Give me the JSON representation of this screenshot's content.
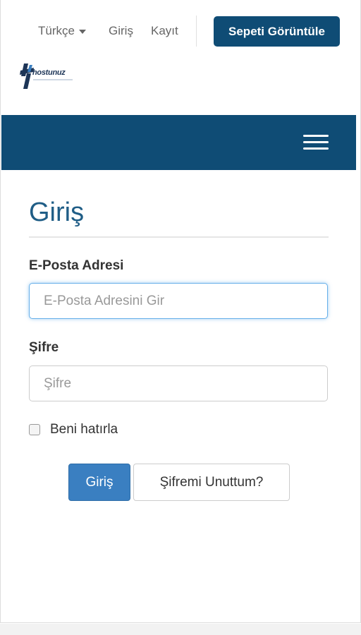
{
  "header": {
    "language_label": "Türkçe",
    "login_link": "Giriş",
    "register_link": "Kayıt",
    "cart_button": "Sepeti Görüntüle",
    "logo_text": "hostunuz"
  },
  "nav": {
    "menu_icon": "hamburger-menu-icon"
  },
  "form": {
    "title": "Giriş",
    "email_label": "E-Posta Adresi",
    "email_placeholder": "E-Posta Adresini Gir",
    "password_label": "Şifre",
    "password_placeholder": "Şifre",
    "remember_label": "Beni hatırla",
    "submit_button": "Giriş",
    "forgot_button": "Şifremi Unuttum?"
  },
  "colors": {
    "brand": "#0f4c75",
    "primary_button": "#3a7fc1",
    "title": "#1f5d86",
    "focus_border": "#66afe9"
  }
}
